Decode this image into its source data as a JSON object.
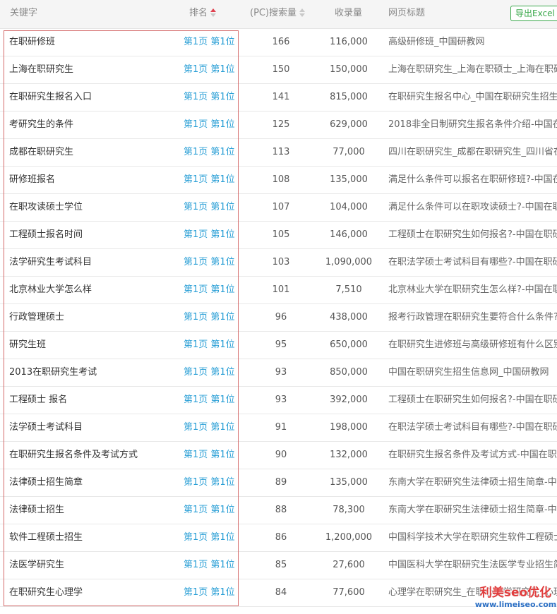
{
  "header": {
    "keyword": "关键字",
    "rank": "排名",
    "volume": "(PC)搜索量",
    "indexed": "收录量",
    "title": "网页标题",
    "export": "导出Excel"
  },
  "rows": [
    {
      "keyword": "在职研修班",
      "rank": "第1页 第1位",
      "volume": "166",
      "indexed": "116,000",
      "title": "高级研修班_中国研教网"
    },
    {
      "keyword": "上海在职研究生",
      "rank": "第1页 第1位",
      "volume": "150",
      "indexed": "150,000",
      "title": "上海在职研究生_上海在职硕士_上海在职研"
    },
    {
      "keyword": "在职研究生报名入口",
      "rank": "第1页 第1位",
      "volume": "141",
      "indexed": "815,000",
      "title": "在职研究生报名中心_中国在职研究生招生信"
    },
    {
      "keyword": "考研究生的条件",
      "rank": "第1页 第1位",
      "volume": "125",
      "indexed": "629,000",
      "title": "2018非全日制研究生报名条件介绍-中国在职"
    },
    {
      "keyword": "成都在职研究生",
      "rank": "第1页 第1位",
      "volume": "113",
      "indexed": "77,000",
      "title": "四川在职研究生_成都在职研究生_四川省在"
    },
    {
      "keyword": "研修班报名",
      "rank": "第1页 第1位",
      "volume": "108",
      "indexed": "135,000",
      "title": "满足什么条件可以报名在职研修班?-中国在"
    },
    {
      "keyword": "在职攻读硕士学位",
      "rank": "第1页 第1位",
      "volume": "107",
      "indexed": "104,000",
      "title": "满足什么条件可以在职攻读硕士?-中国在职"
    },
    {
      "keyword": "工程硕士报名时间",
      "rank": "第1页 第1位",
      "volume": "105",
      "indexed": "146,000",
      "title": "工程硕士在职研究生如何报名?-中国在职研"
    },
    {
      "keyword": "法学研究生考试科目",
      "rank": "第1页 第1位",
      "volume": "103",
      "indexed": "1,090,000",
      "title": "在职法学硕士考试科目有哪些?-中国在职研"
    },
    {
      "keyword": "北京林业大学怎么样",
      "rank": "第1页 第1位",
      "volume": "101",
      "indexed": "7,510",
      "title": "北京林业大学在职研究生怎么样?-中国在职"
    },
    {
      "keyword": "行政管理硕士",
      "rank": "第1页 第1位",
      "volume": "96",
      "indexed": "438,000",
      "title": "报考行政管理在职研究生要符合什么条件?-"
    },
    {
      "keyword": "研究生班",
      "rank": "第1页 第1位",
      "volume": "95",
      "indexed": "650,000",
      "title": "在职研究生进修班与高级研修班有什么区别"
    },
    {
      "keyword": "2013在职研究生考试",
      "rank": "第1页 第1位",
      "volume": "93",
      "indexed": "850,000",
      "title": "中国在职研究生招生信息网_中国研教网"
    },
    {
      "keyword": "工程硕士 报名",
      "rank": "第1页 第1位",
      "volume": "93",
      "indexed": "392,000",
      "title": "工程硕士在职研究生如何报名?-中国在职研"
    },
    {
      "keyword": "法学硕士考试科目",
      "rank": "第1页 第1位",
      "volume": "91",
      "indexed": "198,000",
      "title": "在职法学硕士考试科目有哪些?-中国在职研"
    },
    {
      "keyword": "在职研究生报名条件及考试方式",
      "rank": "第1页 第1位",
      "volume": "90",
      "indexed": "132,000",
      "title": "在职研究生报名条件及考试方式-中国在职研"
    },
    {
      "keyword": "法律硕士招生简章",
      "rank": "第1页 第1位",
      "volume": "89",
      "indexed": "135,000",
      "title": "东南大学在职研究生法律硕士招生简章-中国"
    },
    {
      "keyword": "法律硕士招生",
      "rank": "第1页 第1位",
      "volume": "88",
      "indexed": "78,300",
      "title": "东南大学在职研究生法律硕士招生简章-中国"
    },
    {
      "keyword": "软件工程硕士招生",
      "rank": "第1页 第1位",
      "volume": "86",
      "indexed": "1,200,000",
      "title": "中国科学技术大学在职研究生软件工程硕士"
    },
    {
      "keyword": "法医学研究生",
      "rank": "第1页 第1位",
      "volume": "85",
      "indexed": "27,600",
      "title": "中国医科大学在职研究生法医学专业招生简"
    },
    {
      "keyword": "在职研究生心理学",
      "rank": "第1页 第1位",
      "volume": "84",
      "indexed": "77,600",
      "title": "心理学在职研究生_在职心理学研究生_心理学"
    }
  ],
  "watermark": {
    "line1": "利美seo优化",
    "line2": "www.limeiseo.com"
  }
}
